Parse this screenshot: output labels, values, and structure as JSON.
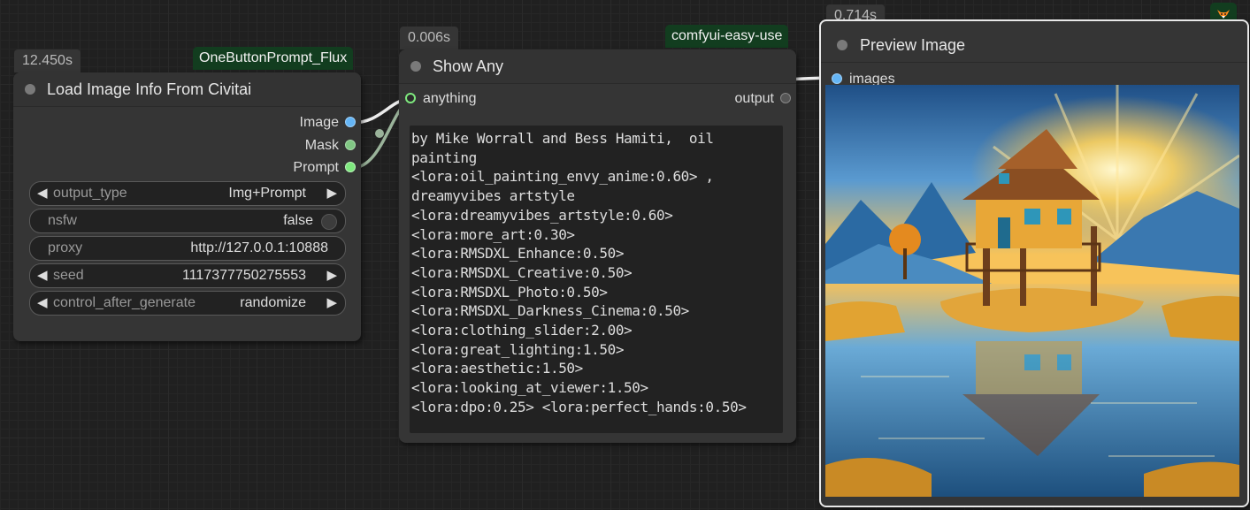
{
  "node1": {
    "timing": "12.450s",
    "badge": "OneButtonPrompt_Flux",
    "title": "Load Image Info From Civitai",
    "outputs": [
      {
        "label": "Image",
        "color": "#64b5f6"
      },
      {
        "label": "Mask",
        "color": "#81c784"
      },
      {
        "label": "Prompt",
        "color": "#7ee87e"
      }
    ],
    "widgets": {
      "output_type": {
        "label": "output_type",
        "value": "Img+Prompt"
      },
      "nsfw": {
        "label": "nsfw",
        "value": "false"
      },
      "proxy": {
        "label": "proxy",
        "value": "http://127.0.0.1:10888"
      },
      "seed": {
        "label": "seed",
        "value": "1117377750275553"
      },
      "control": {
        "label": "control_after_generate",
        "value": "randomize"
      }
    }
  },
  "node2": {
    "timing": "0.006s",
    "badge": "comfyui-easy-use",
    "title": "Show Any",
    "input_label": "anything",
    "output_label": "output",
    "text": "by Mike Worrall and Bess Hamiti,  oil painting\n<lora:oil_painting_envy_anime:0.60> , dreamyvibes artstyle\n<lora:dreamyvibes_artstyle:0.60>\n<lora:more_art:0.30>\n<lora:RMSDXL_Enhance:0.50>\n<lora:RMSDXL_Creative:0.50>\n<lora:RMSDXL_Photo:0.50>\n<lora:RMSDXL_Darkness_Cinema:0.50>\n<lora:clothing_slider:2.00>\n<lora:great_lighting:1.50>\n<lora:aesthetic:1.50>\n<lora:looking_at_viewer:1.50>\n<lora:dpo:0.25> <lora:perfect_hands:0.50>"
  },
  "node3": {
    "timing": "0.714s",
    "title": "Preview Image",
    "input_label": "images",
    "badge_icon": "fox-icon"
  },
  "colors": {
    "canvas": "#202020",
    "node_bg": "#353535",
    "badge_bg": "#123d1f",
    "link": "#e8e8e8",
    "link_green": "#9ab39a",
    "image_slot": "#64b5f6",
    "anything_slot": "#7ee87e"
  }
}
